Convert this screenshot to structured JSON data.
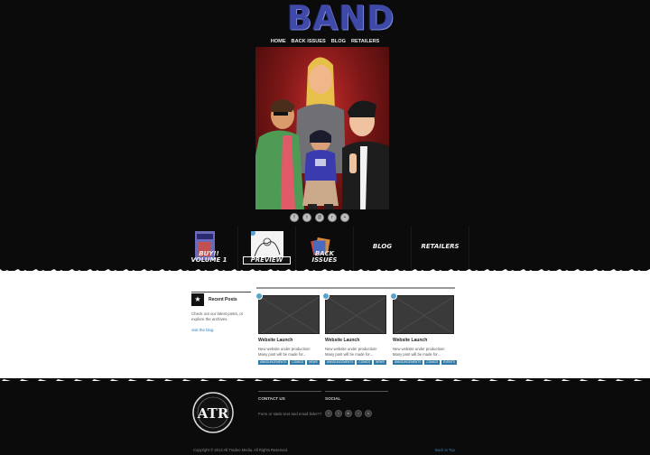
{
  "header": {
    "logo_text": "BAND",
    "nav": [
      "HOME",
      "BACK ISSUES",
      "BLOG",
      "RETAILERS"
    ]
  },
  "hero_social_icons": [
    "facebook-icon",
    "twitter-icon",
    "email-icon",
    "rss-icon",
    "share-icon"
  ],
  "sections": [
    {
      "label": "BUY!!\nVOLUME 1",
      "icon": "book-cover-thumbnail"
    },
    {
      "label": "PREVIEW",
      "icon": "sketch-preview-thumbnail"
    },
    {
      "label": "BACK\nISSUES",
      "icon": "comics-stack-thumbnail"
    },
    {
      "label": "BLOG"
    },
    {
      "label": "RETAILERS"
    }
  ],
  "sidebar": {
    "title": "Recent Posts",
    "description": "Check out our latest posts, or explore the archives.",
    "link": "visit the blog"
  },
  "posts": [
    {
      "title": "Website Launch",
      "excerpt": "New website under production! Many post will be made for...",
      "tags": [
        "ANNOUNCEMENTS",
        "COMICS",
        "NEWS"
      ]
    },
    {
      "title": "Website Launch",
      "excerpt": "New website under production! Many post will be made for...",
      "tags": [
        "ANNOUNCEMENTS",
        "COMICS",
        "NEWS"
      ]
    },
    {
      "title": "Website Launch",
      "excerpt": "New website under production! Many post will be made for...",
      "tags": [
        "ANNOUNCEMENTS",
        "COMICS",
        "EVENTS"
      ]
    }
  ],
  "footer": {
    "contact_heading": "CONTACT US",
    "contact_text": "Form or static text and email links??",
    "social_heading": "SOCIAL",
    "social_icons": [
      "facebook-icon",
      "twitter-icon",
      "linkedin-icon",
      "flickr-icon",
      "skype-icon"
    ],
    "copyright": "Copyright © 2013 All Tradeo Media. All Rights Reserved.",
    "back_to_top": "Back to Top"
  },
  "colors": {
    "accent": "#2e79a8",
    "logo": "#3f4aa8",
    "bg": "#0b0b0b"
  }
}
